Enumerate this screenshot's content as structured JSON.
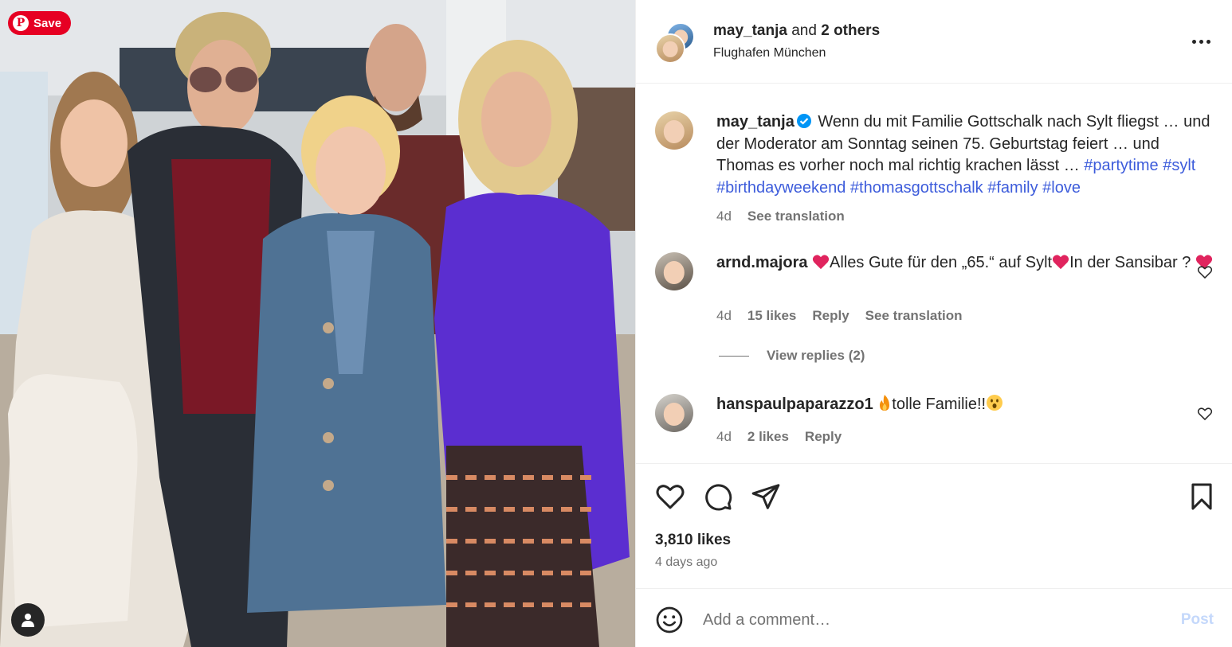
{
  "photo": {
    "save_label": "Save",
    "pin_glyph": "P",
    "icons": {
      "pinterest": "pinterest-icon",
      "tagged_user": "user-icon"
    }
  },
  "header": {
    "username": "may_tanja",
    "and_text": "and",
    "others": "2 others",
    "location": "Flughafen München",
    "more_icon": "more-horizontal-icon"
  },
  "caption": {
    "username": "may_tanja",
    "text_plain": "Wenn du mit Familie Gottschalk nach Sylt fliegst … und der Moderator am Sonntag seinen 75. Geburtstag feiert … und Thomas es vorher noch mal richtig krachen lässt … ",
    "hashtags": [
      "#partytime",
      "#sylt",
      "#birthdayweekend",
      "#thomasgottschalk",
      "#family",
      "#love"
    ],
    "time": "4d",
    "see_translation": "See translation"
  },
  "comments": [
    {
      "username": "arnd.majora",
      "text_part1": "Alles Gute für den „65.“ auf Sylt",
      "text_part2": "In der Sansibar ? ",
      "time": "4d",
      "likes": "15 likes",
      "reply": "Reply",
      "see_translation": "See translation",
      "view_replies": "View replies (2)"
    },
    {
      "username": "hanspaulpaparazzo1",
      "text": "tolle Familie!!",
      "time": "4d",
      "likes": "2 likes",
      "reply": "Reply"
    }
  ],
  "actions": {
    "likes": "3,810 likes",
    "time_ago": "4 days ago",
    "icons": [
      "heart-icon",
      "comment-icon",
      "share-icon",
      "bookmark-icon"
    ]
  },
  "composer": {
    "placeholder": "Add a comment…",
    "post_label": "Post"
  },
  "colors": {
    "hashtag": "#3d5cdb",
    "muted": "#737373",
    "text": "#262626",
    "pinterest": "#e60023",
    "post_disabled": "#c4d8fb",
    "heart_red": "#e0245e",
    "verified": "#0095f6"
  }
}
